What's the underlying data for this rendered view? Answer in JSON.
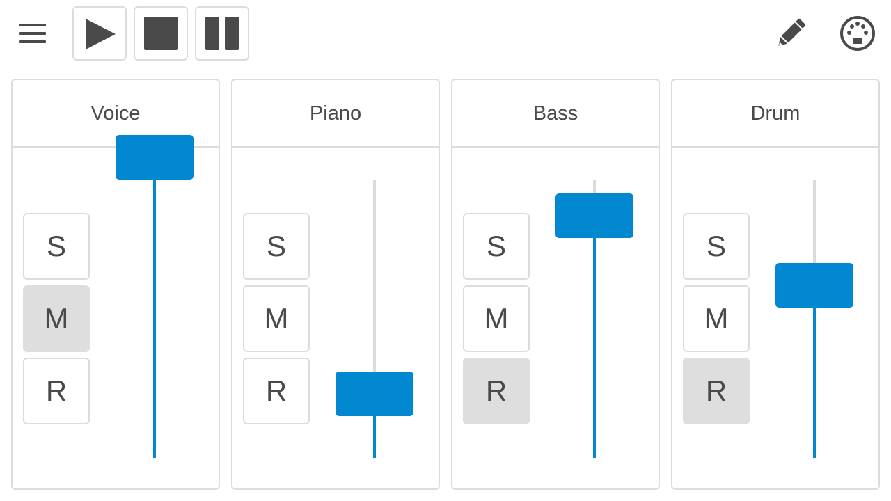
{
  "toolbar": {
    "menu_icon": "hamburger-menu-icon",
    "play_icon": "play-icon",
    "stop_icon": "stop-icon",
    "pause_icon": "pause-icon",
    "edit_icon": "pencil-icon",
    "midi_icon": "midi-connector-icon"
  },
  "colors": {
    "accent": "#0288d1",
    "border": "#dcdcdc",
    "active_button": "#dedede",
    "icon": "#4a4a4a"
  },
  "tracks": [
    {
      "name": "Voice",
      "solo_label": "S",
      "mute_label": "M",
      "record_label": "R",
      "solo_active": false,
      "mute_active": true,
      "record_active": false,
      "volume": 1.0
    },
    {
      "name": "Piano",
      "solo_label": "S",
      "mute_label": "M",
      "record_label": "R",
      "solo_active": false,
      "mute_active": false,
      "record_active": false,
      "volume": 0.15
    },
    {
      "name": "Bass",
      "solo_label": "S",
      "mute_label": "M",
      "record_label": "R",
      "solo_active": false,
      "mute_active": false,
      "record_active": true,
      "volume": 0.79
    },
    {
      "name": "Drum",
      "solo_label": "S",
      "mute_label": "M",
      "record_label": "R",
      "solo_active": false,
      "mute_active": false,
      "record_active": true,
      "volume": 0.54
    }
  ]
}
